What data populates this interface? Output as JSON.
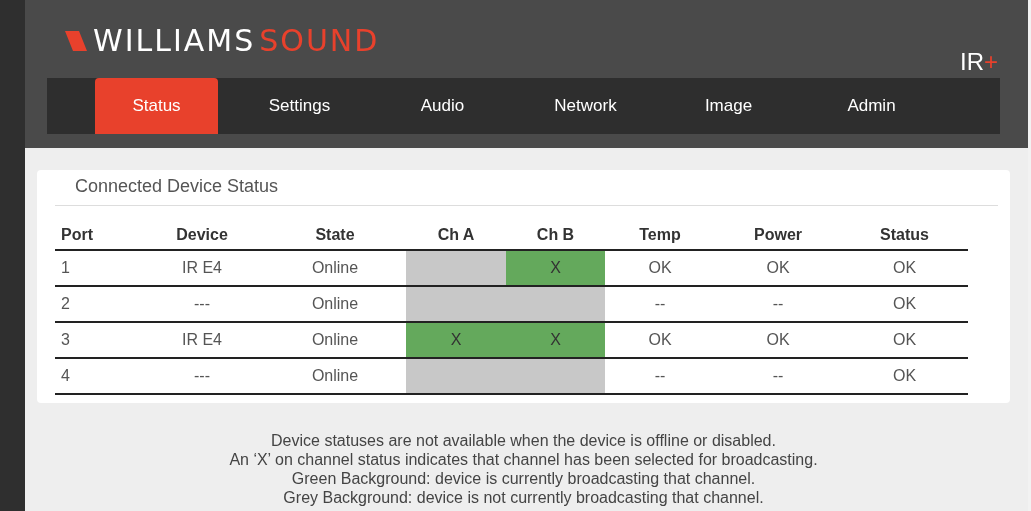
{
  "header": {
    "logo": {
      "part_1": "WILLIAMS",
      "part_2": "SOUND"
    },
    "product": {
      "name": "IR",
      "suffix": "+"
    }
  },
  "tabs": [
    {
      "label": "Status",
      "selected": true
    },
    {
      "label": "Settings",
      "selected": false
    },
    {
      "label": "Audio",
      "selected": false
    },
    {
      "label": "Network",
      "selected": false
    },
    {
      "label": "Image",
      "selected": false
    },
    {
      "label": "Admin",
      "selected": false
    }
  ],
  "panel": {
    "title": "Connected Device Status",
    "table": {
      "columns": [
        "Port",
        "Device",
        "State",
        "Ch A",
        "Ch B",
        "Temp",
        "Power",
        "Status"
      ],
      "rows": [
        {
          "port": "1",
          "device": "IR E4",
          "state": "Online",
          "ch_a": {
            "broadcasting": false
          },
          "ch_b": {
            "mark": "X",
            "broadcasting": true
          },
          "temp": "OK",
          "power": "OK",
          "status": "OK"
        },
        {
          "port": "2",
          "device": "---",
          "state": "Online",
          "ch_a": {
            "broadcasting": false
          },
          "ch_b": {
            "broadcasting": false
          },
          "temp": "--",
          "power": "--",
          "status": "OK"
        },
        {
          "port": "3",
          "device": "IR E4",
          "state": "Online",
          "ch_a": {
            "mark": "X",
            "broadcasting": true
          },
          "ch_b": {
            "mark": "X",
            "broadcasting": true
          },
          "temp": "OK",
          "power": "OK",
          "status": "OK"
        },
        {
          "port": "4",
          "device": "---",
          "state": "Online",
          "ch_a": {
            "broadcasting": false
          },
          "ch_b": {
            "broadcasting": false
          },
          "temp": "--",
          "power": "--",
          "status": "OK"
        }
      ]
    }
  },
  "notes": [
    "Device statuses are not available when the device is offline or disabled.",
    "An ‘X’ on channel status indicates that channel has been selected for broadcasting.",
    "Green Background: device is currently broadcasting that channel.",
    "Grey Background: device is not currently broadcasting that channel."
  ]
}
